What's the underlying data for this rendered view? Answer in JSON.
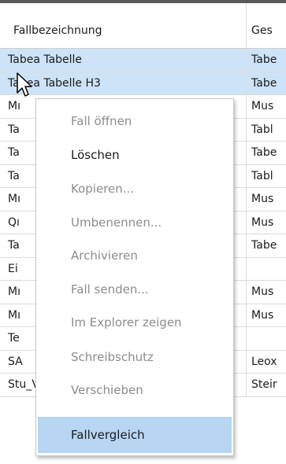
{
  "table": {
    "columns": [
      "Fallbezeichnung",
      "Ges"
    ],
    "rows": [
      {
        "name": "Tabea Tabelle",
        "col2": "Tabe",
        "selected": true
      },
      {
        "name": "Tabea Tabelle H3",
        "col2": "Tabe",
        "selected": true
      },
      {
        "name": "Mı",
        "col2": "Mus"
      },
      {
        "name": "Ta",
        "col2": "Tabl"
      },
      {
        "name": "Ta",
        "col2": "Tabe"
      },
      {
        "name": "Ta",
        "col2": "Tabl"
      },
      {
        "name": "Mı",
        "col2": "Mus"
      },
      {
        "name": "Qı",
        "col2": "Mus"
      },
      {
        "name": "Ta",
        "col2": "Tabe"
      },
      {
        "name": "Ei",
        "col2": ""
      },
      {
        "name": "Mı",
        "col2": "Mus"
      },
      {
        "name": "Mı",
        "col2": "Mus"
      },
      {
        "name": "Te",
        "col2": ""
      },
      {
        "name": "SA",
        "col2": "Leox"
      },
      {
        "name": "Stu_Versorgte einschränken",
        "col2": "Steir"
      }
    ]
  },
  "context_menu": {
    "items": [
      {
        "label": "Fall öffnen",
        "enabled": false
      },
      {
        "label": "Löschen",
        "enabled": true
      },
      {
        "label": "Kopieren...",
        "enabled": false
      },
      {
        "label": "Umbenennen...",
        "enabled": false
      },
      {
        "label": "Archivieren",
        "enabled": false
      },
      {
        "label": "Fall senden...",
        "enabled": false
      },
      {
        "label": "Im Explorer zeigen",
        "enabled": false
      },
      {
        "label": "Schreibschutz",
        "enabled": false
      },
      {
        "label": "Verschieben",
        "enabled": false
      },
      {
        "label": "Fallvergleich",
        "enabled": true,
        "highlighted": true
      }
    ]
  },
  "colors": {
    "selection": "#cde3f7",
    "menu_highlight": "#b6d6f2",
    "disabled_text": "#8c8c8c"
  },
  "icons": {
    "cursor": "mouse-pointer-icon"
  }
}
